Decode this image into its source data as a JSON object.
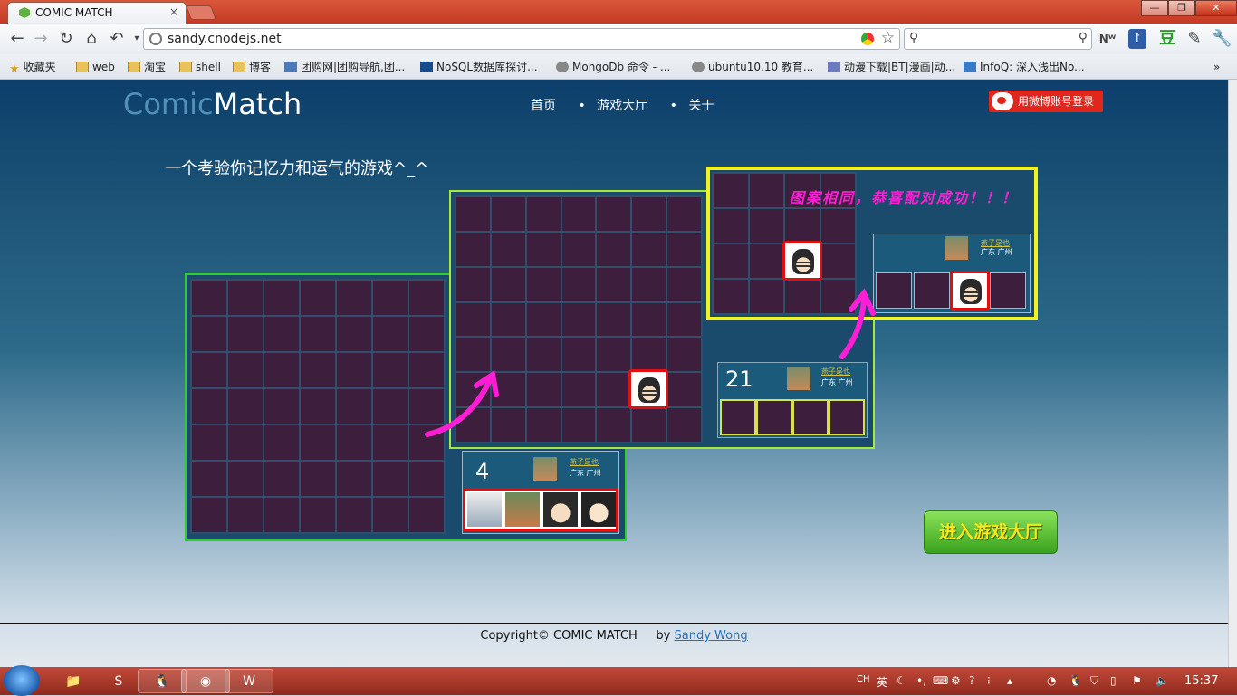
{
  "browser": {
    "tab_title": "COMIC MATCH",
    "tab_close": "×",
    "url": "sandy.cnodejs.net",
    "window_controls": [
      "—",
      "❐",
      "✕"
    ]
  },
  "bookmarks": [
    {
      "label": "收藏夹",
      "icon": "star-icon"
    },
    {
      "label": "web",
      "icon": "folder-icon"
    },
    {
      "label": "淘宝",
      "icon": "folder-icon"
    },
    {
      "label": "shell",
      "icon": "folder-icon"
    },
    {
      "label": "博客",
      "icon": "folder-icon"
    },
    {
      "label": "团购网|团购导航,团...",
      "icon": "page-icon"
    },
    {
      "label": "NoSQL数据库探讨...",
      "icon": "page-icon"
    },
    {
      "label": "MongoDb 命令 - ...",
      "icon": "globe-icon"
    },
    {
      "label": "ubuntu10.10 教育...",
      "icon": "globe-icon"
    },
    {
      "label": "动漫下载|BT|漫画|动...",
      "icon": "page-icon"
    },
    {
      "label": "InfoQ: 深入浅出No...",
      "icon": "page-icon"
    }
  ],
  "bookmarks_more": "»",
  "site": {
    "logo_part1": "Comic",
    "logo_part2": "Match",
    "nav": [
      "首页",
      "游戏大厅",
      "关于"
    ],
    "nav_sep": "•",
    "weibo_login": "用微博账号登录",
    "slogan": "一个考验你记忆力和运气的游戏^_^",
    "caption": "图案相同，恭喜配对成功！！！",
    "enter_button": "进入游戏大厅",
    "copyright": "Copyright© COMIC MATCH",
    "by": "by",
    "author": "Sandy Wong"
  },
  "boards": {
    "board1_score": "4",
    "board2_score": "21",
    "player_name": "燕子是也",
    "player_loc": "广东 广州"
  },
  "taskbar": {
    "lang": "CH",
    "ime": "英",
    "time": "15:37"
  },
  "colors": {
    "accent": "#1b5a7a",
    "board_border": "#2ccf2c",
    "highlight": "#e01010",
    "yellow_border": "#f4f21e",
    "caption": "#ff1ed6"
  }
}
